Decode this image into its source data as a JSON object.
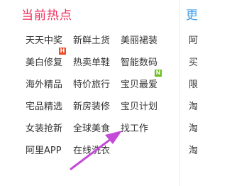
{
  "section": {
    "title": "当前热点",
    "links": [
      "天天中奖",
      "新鲜土货",
      "美丽裙装",
      "美白修复",
      "热卖单鞋",
      "智能数码",
      "海外精品",
      "特价旅行",
      "宝贝最爱",
      "宅品精选",
      "新房装修",
      "宝贝计划",
      "女装抢新",
      "全球美食",
      "找工作",
      "阿里APP",
      "在线洗衣"
    ],
    "badges": {
      "hot": "H",
      "new": "N"
    }
  },
  "next_section": {
    "title_fragment": "更",
    "link_fragments": [
      "阿",
      "买",
      "限",
      "淘",
      "淘",
      "淘"
    ]
  },
  "colors": {
    "title": "#ef2c5b",
    "hot_badge": "#ef4b26",
    "new_badge": "#6cbf1e",
    "arrow": "#c34bd8",
    "next_title": "#3a9be6"
  }
}
